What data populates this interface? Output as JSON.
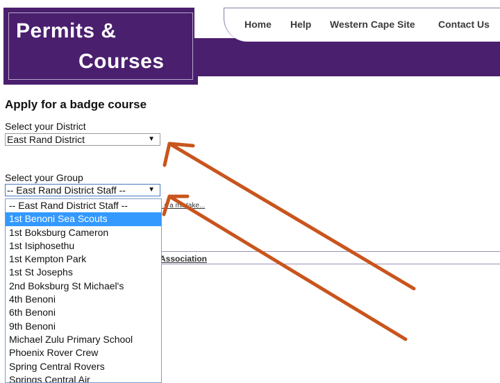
{
  "brand": {
    "line1": "Permits &",
    "line2": "Courses",
    "color": "#4a1f6e"
  },
  "nav": {
    "home": "Home",
    "help": "Help",
    "western_cape": "Western Cape Site",
    "contact": "Contact Us"
  },
  "page": {
    "title": "Apply for a badge course",
    "district_label": "Select your District",
    "district_value": "East Rand District",
    "group_label": "Select your Group",
    "group_value": "-- East Rand District Staff --",
    "mistake_link": "...s a mistake...",
    "association_link": "Association"
  },
  "group_options": [
    "-- East Rand District Staff --",
    "1st Benoni Sea Scouts",
    "1st Boksburg Cameron",
    "1st Isiphosethu",
    "1st Kempton Park",
    "1st St Josephs",
    "2nd Boksburg St Michael's",
    "4th Benoni",
    "6th Benoni",
    "9th Benoni",
    "Michael Zulu Primary School",
    "Phoenix Rover Crew",
    "Spring Central Rovers",
    "Springs Central Air"
  ],
  "highlighted_option": "1st Benoni Sea Scouts",
  "annotation_color": "#c8551d"
}
